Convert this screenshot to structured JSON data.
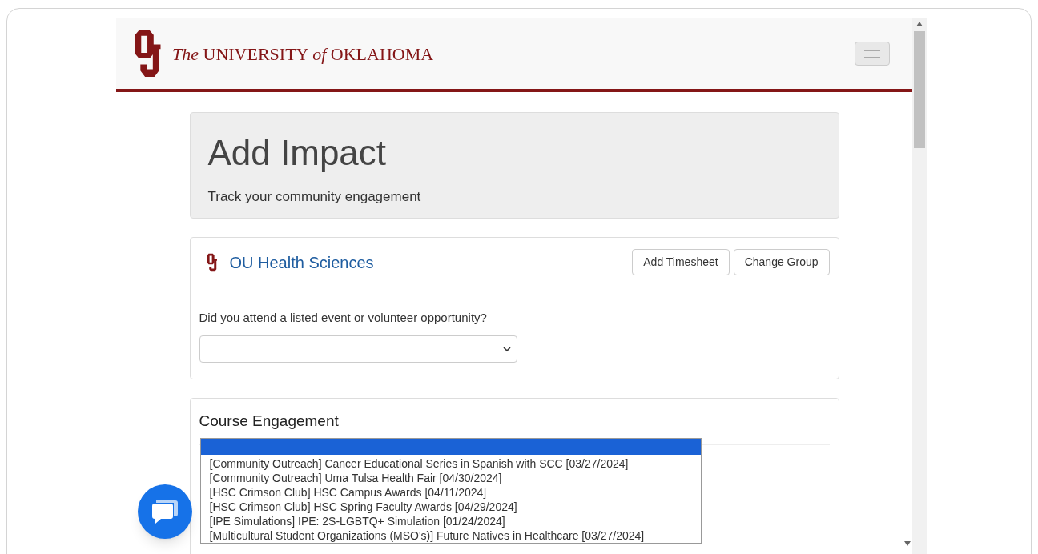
{
  "header": {
    "brand": "*The* UNIVERSITY *of* OKLAHOMA"
  },
  "jumbotron": {
    "title": "Add Impact",
    "subtitle": "Track your community engagement"
  },
  "group_card": {
    "name": "OU Health Sciences",
    "buttons": [
      "Add Timesheet",
      "Change Group"
    ],
    "question": "Did you attend a listed event or volunteer opportunity?"
  },
  "course_card": {
    "title": "Course Engagement"
  },
  "dropdown_options": [
    {
      "selected": true
    },
    {
      "label": "[Community Outreach] Cancer Educational Series in Spanish with SCC [03/27/2024]",
      "selected": false
    },
    {
      "label": "[Community Outreach] Uma Tulsa Health Fair [04/30/2024]",
      "selected": false
    },
    {
      "label": "[HSC Crimson Club] HSC Campus Awards [04/11/2024]",
      "selected": false
    },
    {
      "label": "[HSC Crimson Club] HSC Spring Faculty Awards [04/29/2024]",
      "selected": false
    },
    {
      "label": "[IPE Simulations] IPE: 2S-LGBTQ+ Simulation [01/24/2024]",
      "selected": false
    },
    {
      "label": "[Multicultural Student Organizations (MSO's)] Future Natives in Healthcare [03/27/2024]",
      "selected": false
    }
  ]
}
